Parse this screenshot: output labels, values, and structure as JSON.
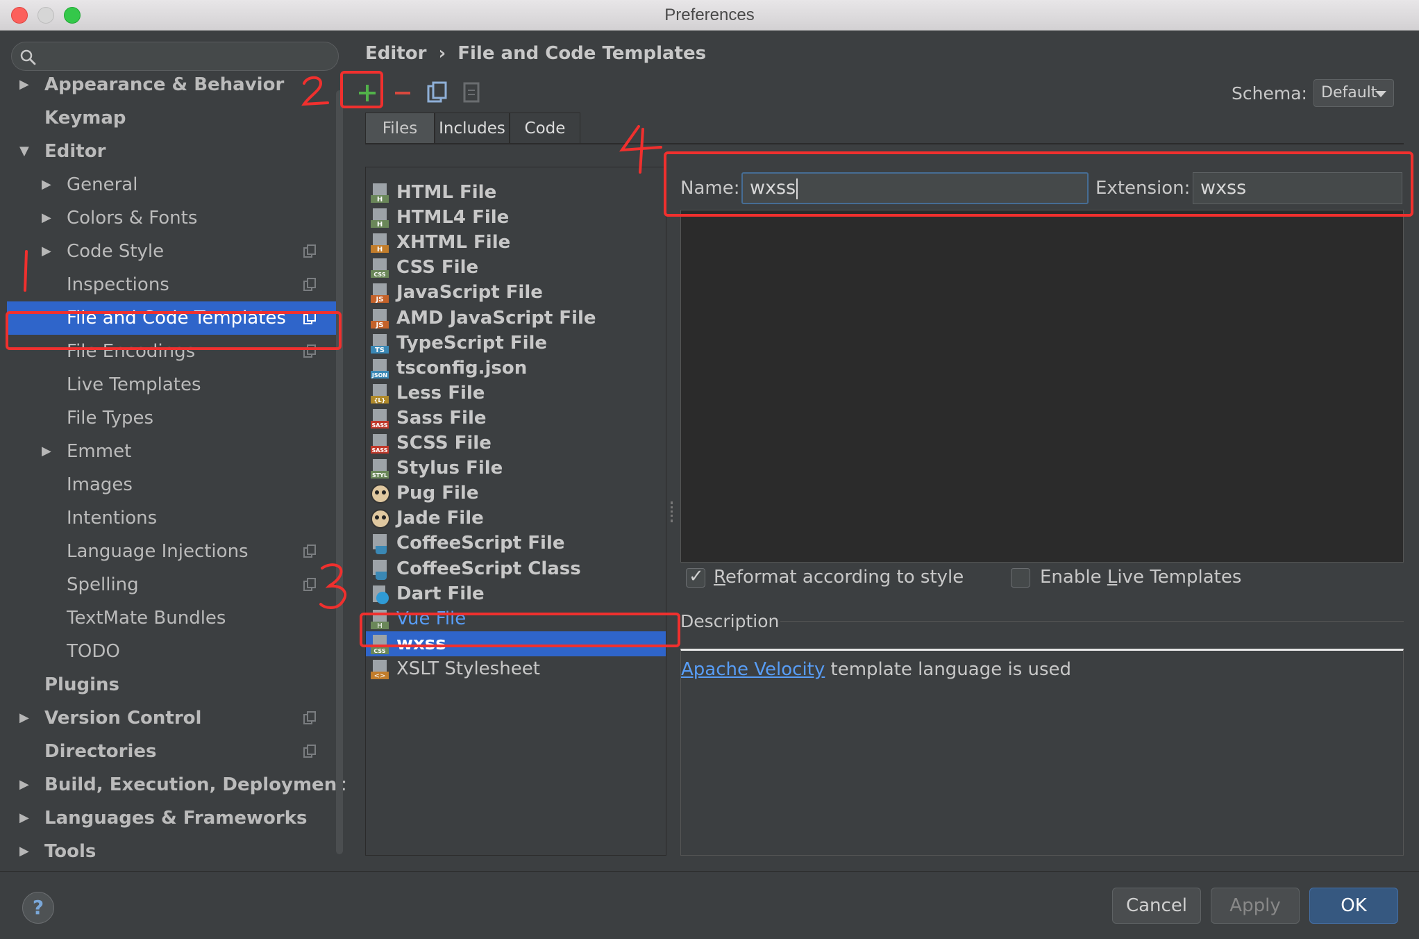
{
  "window": {
    "title": "Preferences"
  },
  "search": {
    "placeholder": ""
  },
  "tree": [
    {
      "label": "Appearance & Behavior",
      "bold": true,
      "arrow": "right",
      "indent": 0,
      "copy": false
    },
    {
      "label": "Keymap",
      "bold": true,
      "arrow": "",
      "indent": 0,
      "copy": false
    },
    {
      "label": "Editor",
      "bold": true,
      "arrow": "down",
      "indent": 0,
      "copy": false
    },
    {
      "label": "General",
      "bold": false,
      "arrow": "right",
      "indent": 1,
      "copy": false
    },
    {
      "label": "Colors & Fonts",
      "bold": false,
      "arrow": "right",
      "indent": 1,
      "copy": false
    },
    {
      "label": "Code Style",
      "bold": false,
      "arrow": "right",
      "indent": 1,
      "copy": true
    },
    {
      "label": "Inspections",
      "bold": false,
      "arrow": "",
      "indent": 1,
      "copy": true
    },
    {
      "label": "File and Code Templates",
      "bold": false,
      "arrow": "",
      "indent": 1,
      "copy": true,
      "selected": true
    },
    {
      "label": "File Encodings",
      "bold": false,
      "arrow": "",
      "indent": 1,
      "copy": true
    },
    {
      "label": "Live Templates",
      "bold": false,
      "arrow": "",
      "indent": 1,
      "copy": false
    },
    {
      "label": "File Types",
      "bold": false,
      "arrow": "",
      "indent": 1,
      "copy": false
    },
    {
      "label": "Emmet",
      "bold": false,
      "arrow": "right",
      "indent": 1,
      "copy": false
    },
    {
      "label": "Images",
      "bold": false,
      "arrow": "",
      "indent": 1,
      "copy": false
    },
    {
      "label": "Intentions",
      "bold": false,
      "arrow": "",
      "indent": 1,
      "copy": false
    },
    {
      "label": "Language Injections",
      "bold": false,
      "arrow": "",
      "indent": 1,
      "copy": true
    },
    {
      "label": "Spelling",
      "bold": false,
      "arrow": "",
      "indent": 1,
      "copy": true
    },
    {
      "label": "TextMate Bundles",
      "bold": false,
      "arrow": "",
      "indent": 1,
      "copy": false
    },
    {
      "label": "TODO",
      "bold": false,
      "arrow": "",
      "indent": 1,
      "copy": false
    },
    {
      "label": "Plugins",
      "bold": true,
      "arrow": "",
      "indent": 0,
      "copy": false
    },
    {
      "label": "Version Control",
      "bold": true,
      "arrow": "right",
      "indent": 0,
      "copy": true
    },
    {
      "label": "Directories",
      "bold": true,
      "arrow": "",
      "indent": 0,
      "copy": true
    },
    {
      "label": "Build, Execution, Deployment",
      "bold": true,
      "arrow": "right",
      "indent": 0,
      "copy": false
    },
    {
      "label": "Languages & Frameworks",
      "bold": true,
      "arrow": "right",
      "indent": 0,
      "copy": false
    },
    {
      "label": "Tools",
      "bold": true,
      "arrow": "right",
      "indent": 0,
      "copy": false
    }
  ],
  "breadcrumb": {
    "parent": "Editor",
    "separator": "›",
    "current": "File and Code Templates"
  },
  "toolbar": {
    "add": "+",
    "remove": "−"
  },
  "schema": {
    "label": "Schema:",
    "value": "Default"
  },
  "tabs": [
    "Files",
    "Includes",
    "Code"
  ],
  "files": [
    {
      "label": "HTML File",
      "icon": "H",
      "color": "#6a8759",
      "style": "bold"
    },
    {
      "label": "HTML4 File",
      "icon": "H",
      "color": "#6a8759",
      "style": "bold"
    },
    {
      "label": "XHTML File",
      "icon": "H",
      "color": "#c27d2b",
      "style": "bold"
    },
    {
      "label": "CSS File",
      "icon": "CSS",
      "color": "#6a8759",
      "style": "bold"
    },
    {
      "label": "JavaScript File",
      "icon": "JS",
      "color": "#c4622a",
      "style": "bold"
    },
    {
      "label": "AMD JavaScript File",
      "icon": "JS",
      "color": "#c4622a",
      "style": "bold"
    },
    {
      "label": "TypeScript File",
      "icon": "TS",
      "color": "#3a88b5",
      "style": "bold"
    },
    {
      "label": "tsconfig.json",
      "icon": "JSON",
      "color": "#3a88b5",
      "style": "bold"
    },
    {
      "label": "Less File",
      "icon": "{L}",
      "color": "#b08a2b",
      "style": "bold"
    },
    {
      "label": "Sass File",
      "icon": "SASS",
      "color": "#c0392b",
      "style": "bold"
    },
    {
      "label": "SCSS File",
      "icon": "SASS",
      "color": "#c0392b",
      "style": "bold"
    },
    {
      "label": "Stylus File",
      "icon": "STYL",
      "color": "#6a8759",
      "style": "bold"
    },
    {
      "label": "Pug File",
      "icon": "pug",
      "color": "#e0c8a0",
      "style": "bold"
    },
    {
      "label": "Jade File",
      "icon": "pug",
      "color": "#e0c8a0",
      "style": "bold"
    },
    {
      "label": "CoffeeScript File",
      "icon": "coffee",
      "color": "#3a88b5",
      "style": "bold"
    },
    {
      "label": "CoffeeScript Class",
      "icon": "coffee",
      "color": "#3a88b5",
      "style": "bold"
    },
    {
      "label": "Dart File",
      "icon": "dart",
      "color": "#2f9bd6",
      "style": "bold"
    },
    {
      "label": "Vue File",
      "icon": "H",
      "color": "#6a8759",
      "style": "link"
    },
    {
      "label": "wxss",
      "icon": "CSS",
      "color": "#6a8759",
      "style": "selected"
    },
    {
      "label": "XSLT Stylesheet",
      "icon": "<>",
      "color": "#c27d2b",
      "style": "plain"
    }
  ],
  "form": {
    "name_label": "Name:",
    "name_value": "wxss",
    "ext_label": "Extension:",
    "ext_value": "wxss"
  },
  "options": {
    "reformat_prefix": "R",
    "reformat_rest": "eformat according to style",
    "reformat_checked": true,
    "live_prefix": "Enable ",
    "live_underline": "L",
    "live_rest": "ive Templates",
    "live_checked": false
  },
  "description": {
    "label": "Description",
    "link": "Apache Velocity",
    "text": " template language is used"
  },
  "buttons": {
    "cancel": "Cancel",
    "apply": "Apply",
    "ok": "OK",
    "help": "?"
  },
  "annotations": [
    "1",
    "2",
    "3",
    "4"
  ],
  "colors": {
    "accent": "#2f65ca",
    "annotation": "#f0302e",
    "link": "#589df6"
  }
}
